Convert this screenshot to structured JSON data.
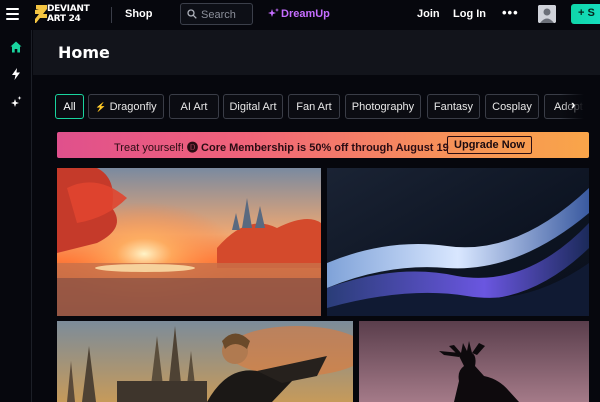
{
  "topbar": {
    "logo_line1": "DEVIANT",
    "logo_line2": "ART 24",
    "shop": "Shop",
    "search_placeholder": "Search",
    "dreamup": "DreamUp",
    "join": "Join",
    "login": "Log In",
    "more": "•••",
    "submit": "+ S"
  },
  "icons": {
    "menu": "hamburger-icon",
    "search": "search-icon",
    "dreamup": "sparkle-icon",
    "avatar": "user-icon",
    "home": "home-icon",
    "bolt": "bolt-icon",
    "sparkle": "sparkle-icon",
    "next": "chevron-right-icon"
  },
  "colors": {
    "accent": "#19d49e",
    "dreamup": "#c56dff",
    "promo_start": "#e0508c",
    "promo_end": "#f9a549"
  },
  "page": {
    "title": "Home"
  },
  "chips": [
    {
      "label": "All",
      "active": true
    },
    {
      "label": "Dragonfly",
      "icon": "bolt"
    },
    {
      "label": "AI Art"
    },
    {
      "label": "Digital Art"
    },
    {
      "label": "Fan Art"
    },
    {
      "label": "Photography"
    },
    {
      "label": "Fantasy"
    },
    {
      "label": "Cosplay"
    },
    {
      "label": "Adopt"
    }
  ],
  "promo": {
    "lead": "Treat yourself!",
    "glyph": "🅓",
    "offer": "Core Membership is 50% off through August 19",
    "button": "Upgrade Now"
  }
}
